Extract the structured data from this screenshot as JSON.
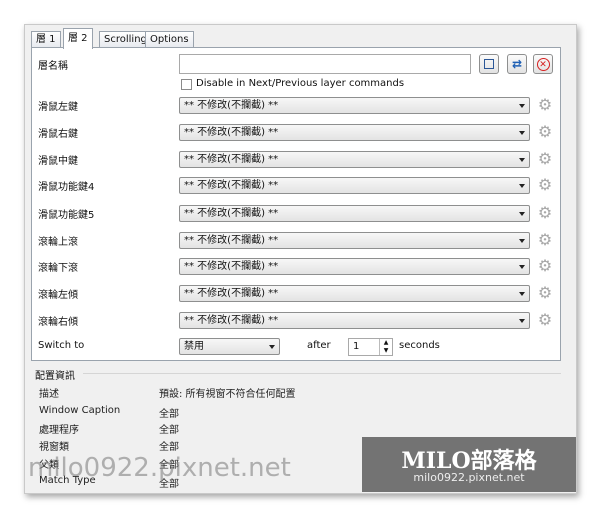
{
  "tabs": [
    "層 1",
    "層 2",
    "Scrolling",
    "Options"
  ],
  "layer_name": {
    "label": "層名稱",
    "value": "",
    "disable_checkbox_label": "Disable in Next/Previous layer commands"
  },
  "button_rows": [
    {
      "label": "滑鼠左鍵",
      "value": "** 不修改(不攔截) **"
    },
    {
      "label": "滑鼠右鍵",
      "value": "** 不修改(不攔截) **"
    },
    {
      "label": "滑鼠中鍵",
      "value": "** 不修改(不攔截) **"
    },
    {
      "label": "滑鼠功能鍵4",
      "value": "** 不修改(不攔截) **"
    },
    {
      "label": "滑鼠功能鍵5",
      "value": "** 不修改(不攔截) **"
    },
    {
      "label": "滾輪上滾",
      "value": "** 不修改(不攔截) **"
    },
    {
      "label": "滾輪下滾",
      "value": "** 不修改(不攔截) **"
    },
    {
      "label": "滾輪左傾",
      "value": "** 不修改(不攔截) **"
    },
    {
      "label": "滾輪右傾",
      "value": "** 不修改(不攔截) **"
    }
  ],
  "switch_to": {
    "label": "Switch to",
    "value": "禁用",
    "after_label": "after",
    "seconds_value": "1",
    "seconds_label": "seconds"
  },
  "config_info": {
    "title": "配置資訊",
    "rows": [
      {
        "key": "描述",
        "value": "預設: 所有視窗不符合任何配置"
      },
      {
        "key": "Window Caption",
        "value": "全部"
      },
      {
        "key": "處理程序",
        "value": "全部"
      },
      {
        "key": "視窗類",
        "value": "全部"
      },
      {
        "key": "父類",
        "value": "全部"
      },
      {
        "key": "Match Type",
        "value": "全部"
      }
    ]
  },
  "watermark": {
    "title": "MILO部落格",
    "subtitle": "milo0922.pixnet.net",
    "overlay_text": "milo0922.pixnet.net"
  },
  "colors": {
    "accent_blue": "#1e5fb4",
    "delete_red": "#d62020",
    "gear_gray": "#a8a8a8"
  }
}
